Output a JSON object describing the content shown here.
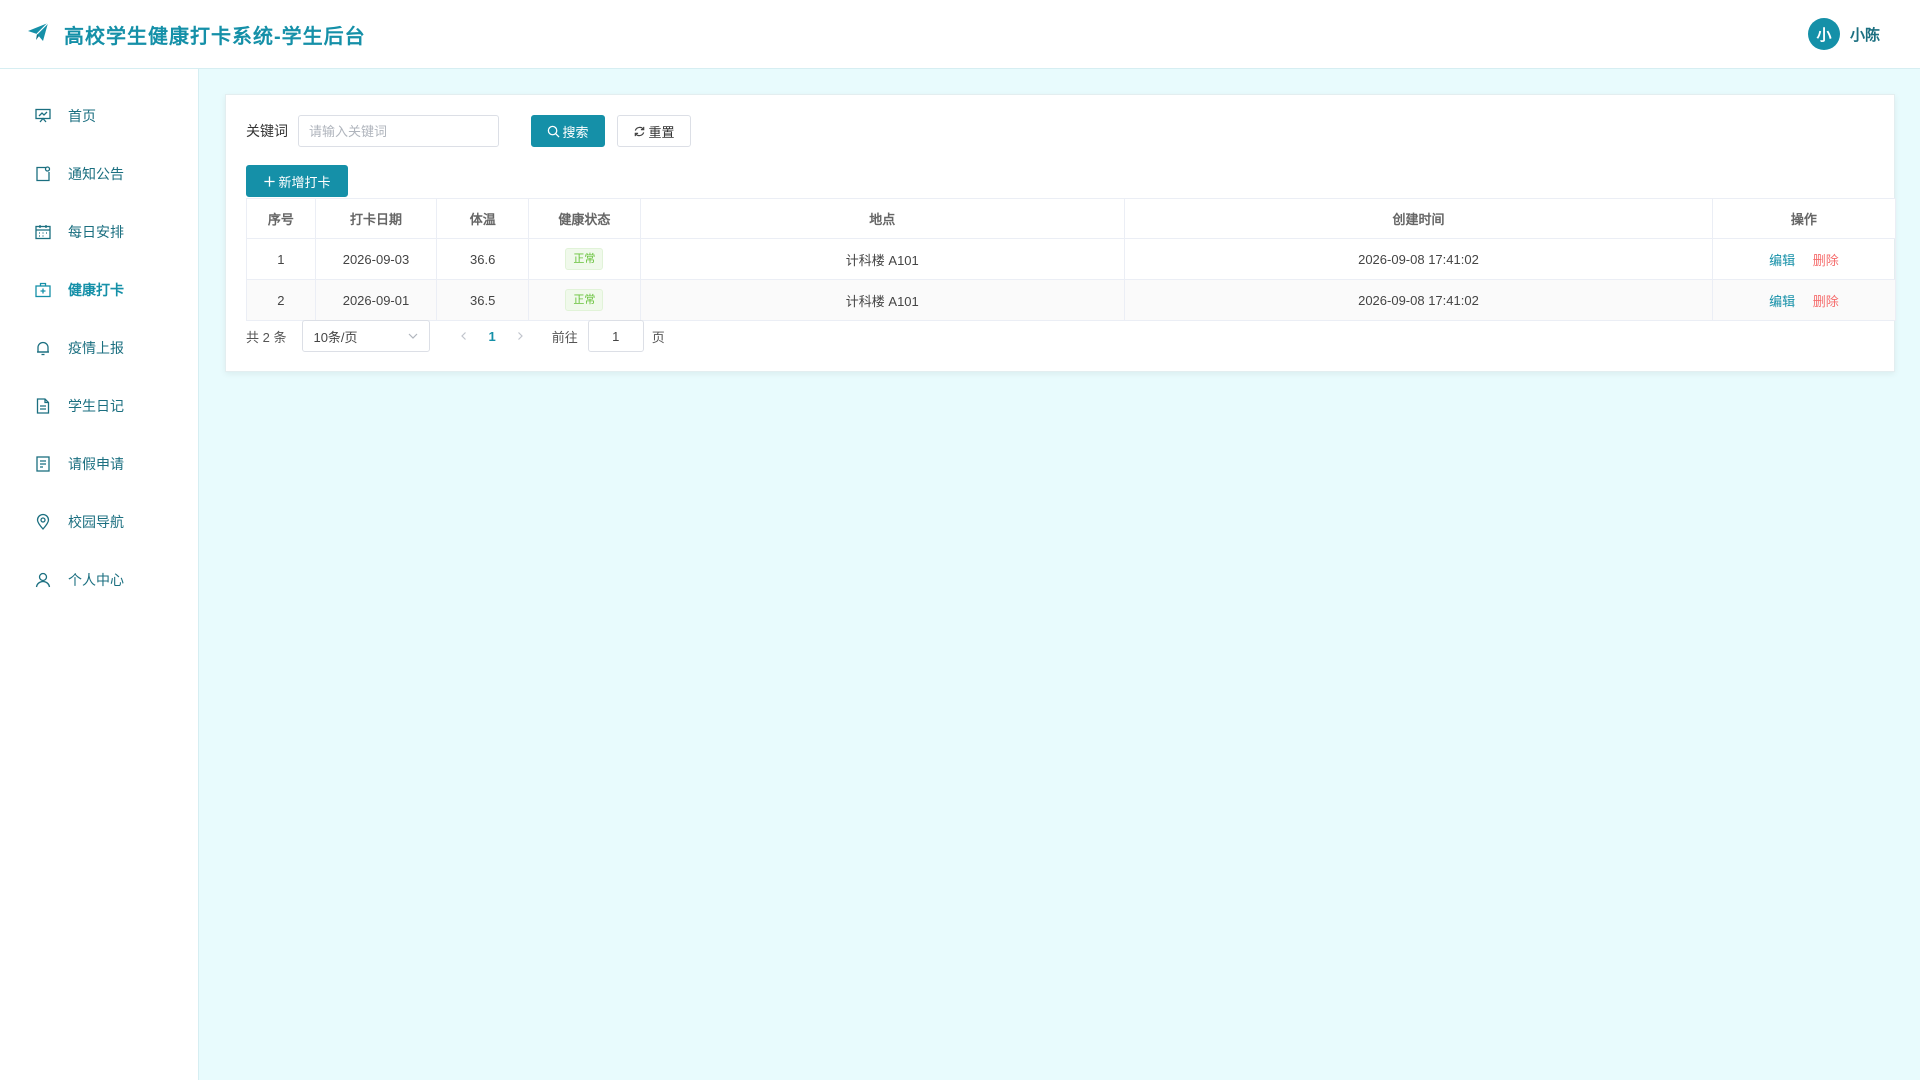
{
  "header": {
    "title": "高校学生健康打卡系统-学生后台",
    "avatar_text": "小",
    "username": "小陈",
    "logo_icon": "paper-plane-icon",
    "accent_color": "#1590a8"
  },
  "sidebar": {
    "items": [
      {
        "label": "首页",
        "icon": "presentation-icon"
      },
      {
        "label": "通知公告",
        "icon": "notice-icon"
      },
      {
        "label": "每日安排",
        "icon": "calendar-icon"
      },
      {
        "label": "健康打卡",
        "icon": "medical-box-icon",
        "active": true
      },
      {
        "label": "疫情上报",
        "icon": "bell-icon"
      },
      {
        "label": "学生日记",
        "icon": "document-icon"
      },
      {
        "label": "请假申请",
        "icon": "tickets-icon"
      },
      {
        "label": "校园导航",
        "icon": "location-icon"
      },
      {
        "label": "个人中心",
        "icon": "user-icon"
      }
    ]
  },
  "search": {
    "label": "关键词",
    "placeholder": "请输入关键词",
    "value": "",
    "search_button": "搜索",
    "reset_button": "重置"
  },
  "add_button": "新增打卡",
  "table": {
    "columns": [
      "序号",
      "打卡日期",
      "体温",
      "健康状态",
      "地点",
      "创建时间",
      "操作"
    ],
    "rows": [
      {
        "index": "1",
        "date": "2026-09-03",
        "temperature": "36.6",
        "status": "正常",
        "location": "计科楼 A101",
        "created": "2026-09-08 17:41:02",
        "edit": "编辑",
        "delete": "删除"
      },
      {
        "index": "2",
        "date": "2026-09-01",
        "temperature": "36.5",
        "status": "正常",
        "location": "计科楼 A101",
        "created": "2026-09-08 17:41:02",
        "edit": "编辑",
        "delete": "删除"
      }
    ]
  },
  "pagination": {
    "total": "共 2 条",
    "page_size": "10条/页",
    "current_page": "1",
    "goto_label": "前往",
    "goto_value": "1",
    "page_unit": "页"
  }
}
